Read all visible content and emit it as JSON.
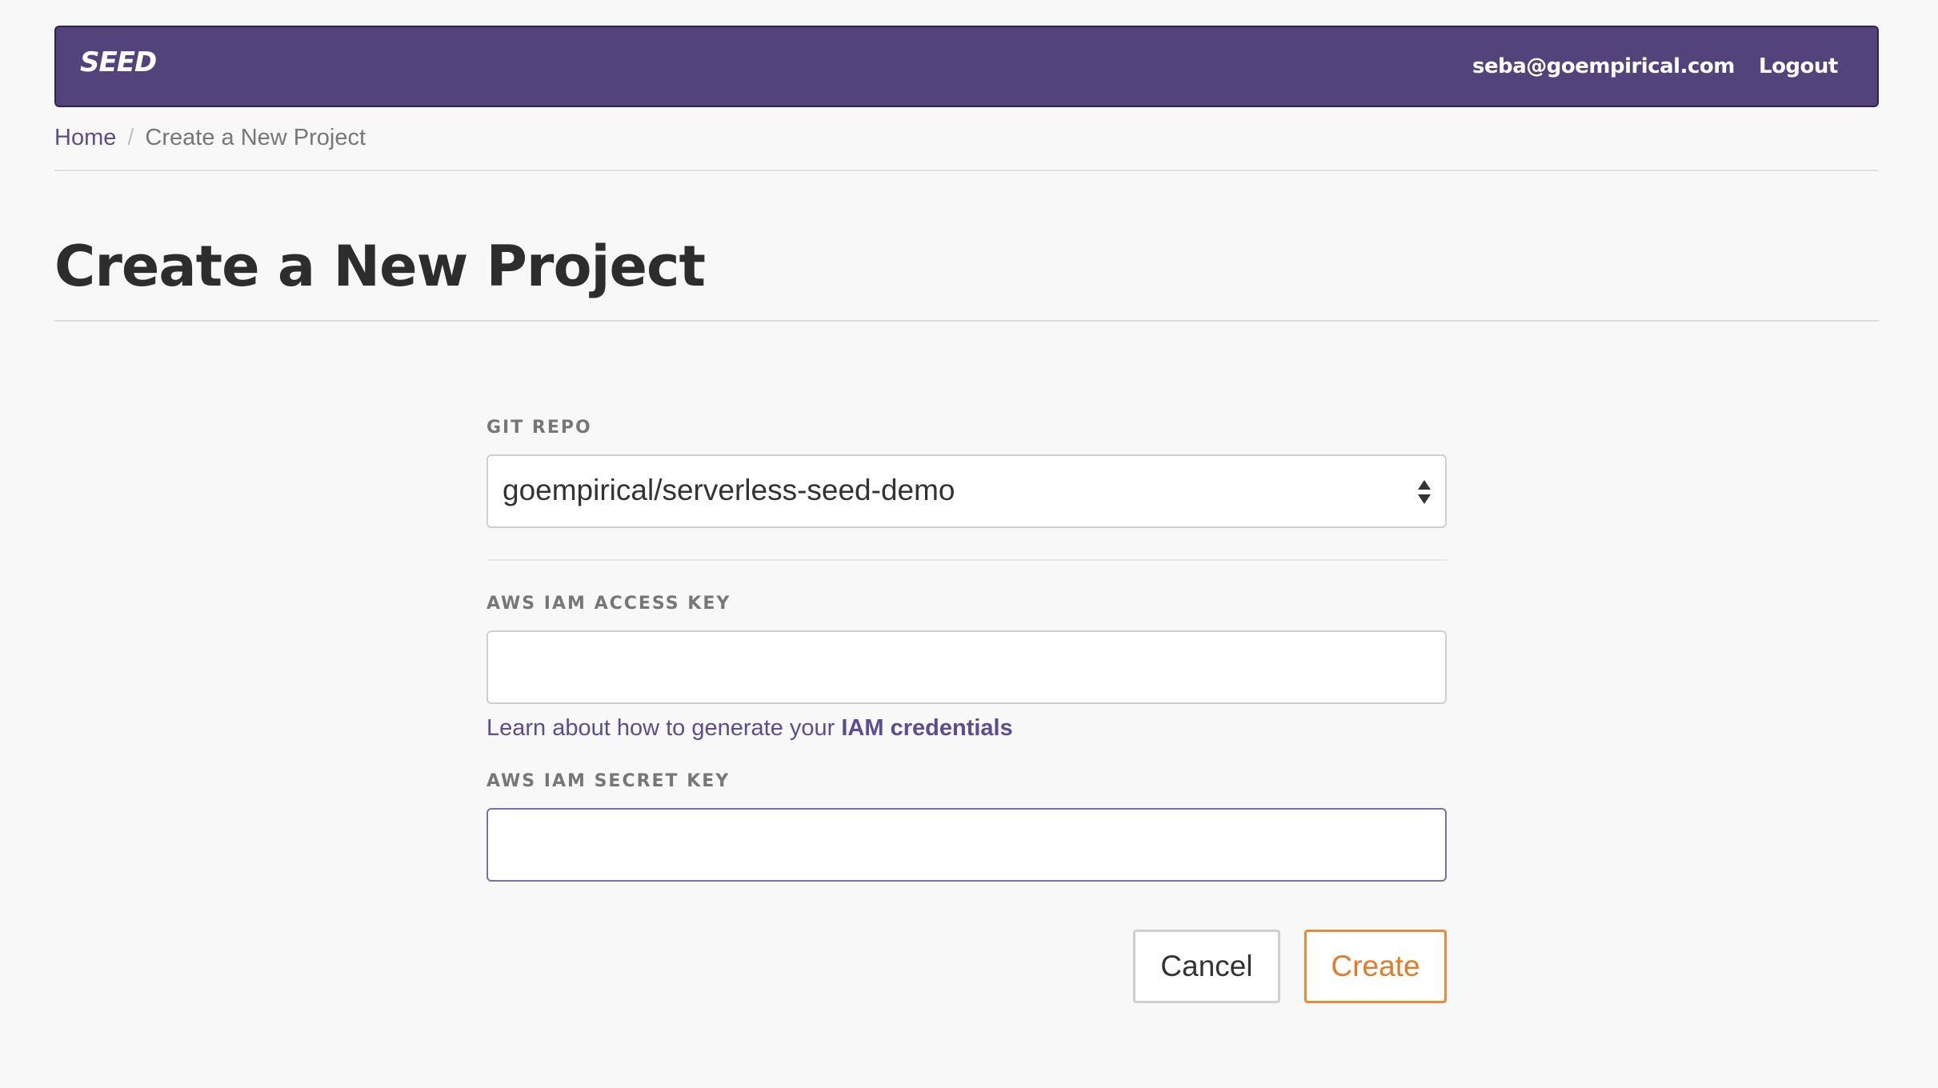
{
  "navbar": {
    "brand": "SEED",
    "user_email": "seba@goempirical.com",
    "logout_label": "Logout",
    "background_color": "#52447a"
  },
  "breadcrumb": {
    "home": "Home",
    "separator": "/",
    "current": "Create a New Project"
  },
  "page": {
    "title": "Create a New Project"
  },
  "form": {
    "git_repo": {
      "label": "GIT REPO",
      "selected_value": "goempirical/serverless-seed-demo",
      "icon": "select-arrows-icon"
    },
    "access_key": {
      "label": "AWS IAM ACCESS KEY",
      "value": "",
      "placeholder": ""
    },
    "help": {
      "text": "Learn about how to generate your ",
      "link_text": "IAM credentials"
    },
    "secret_key": {
      "label": "AWS IAM SECRET KEY",
      "value": "",
      "placeholder": ""
    },
    "actions": {
      "cancel_label": "Cancel",
      "create_label": "Create",
      "create_color": "#e27b2a"
    }
  }
}
